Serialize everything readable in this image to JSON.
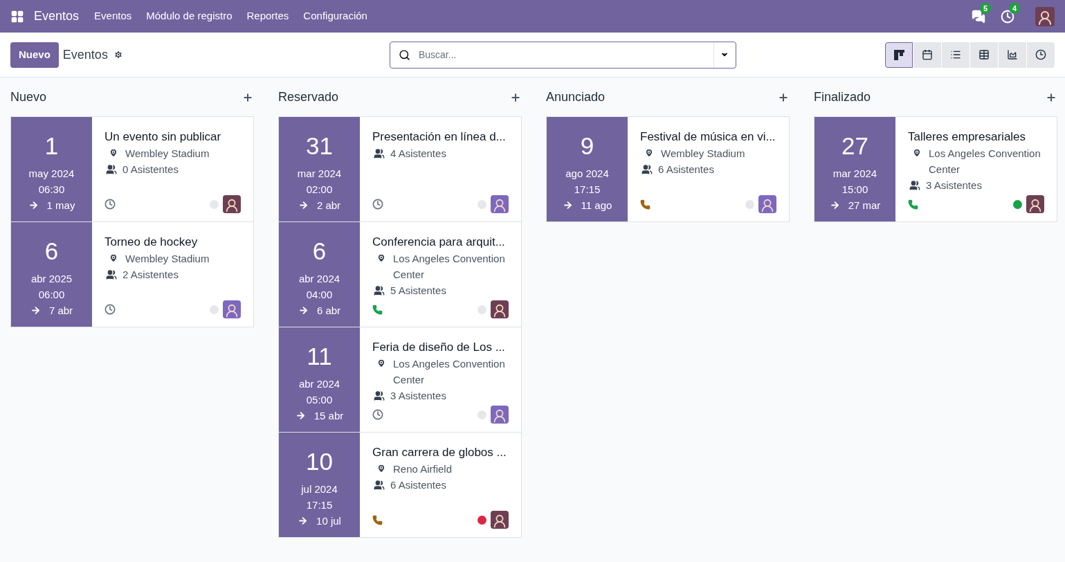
{
  "navbar": {
    "app_name": "Eventos",
    "menu": [
      "Eventos",
      "Módulo de registro",
      "Reportes",
      "Configuración"
    ],
    "messages_badge": "5",
    "activities_badge": "4"
  },
  "control_panel": {
    "new_button": "Nuevo",
    "breadcrumb": "Eventos",
    "search": {
      "placeholder": "Buscar..."
    },
    "views": [
      {
        "kind": "kanban",
        "selected": true
      },
      {
        "kind": "calendar",
        "selected": false
      },
      {
        "kind": "list",
        "selected": false
      },
      {
        "kind": "pivot",
        "selected": false
      },
      {
        "kind": "graph",
        "selected": false
      },
      {
        "kind": "activity",
        "selected": false
      }
    ]
  },
  "columns": [
    {
      "title": "Nuevo",
      "cards": [
        {
          "day": "1",
          "month_year": "may 2024",
          "time": "06:30",
          "end": "1 may",
          "title": "Un evento sin publicar",
          "location": "Wembley Stadium",
          "attendees": "0 Asistentes",
          "activity": {
            "kind": "clock",
            "color": "#6b7280"
          },
          "status_dot": {
            "color": "#e5e7eb"
          },
          "avatar": {
            "color": "#6e3f52"
          }
        },
        {
          "day": "6",
          "month_year": "abr 2025",
          "time": "06:00",
          "end": "7 abr",
          "title": "Torneo de hockey",
          "location": "Wembley Stadium",
          "attendees": "2 Asistentes",
          "activity": {
            "kind": "clock",
            "color": "#6b7280"
          },
          "status_dot": {
            "color": "#e5e7eb"
          },
          "avatar": {
            "color": "#7d68c0"
          }
        }
      ]
    },
    {
      "title": "Reservado",
      "cards": [
        {
          "day": "31",
          "month_year": "mar 2024",
          "time": "02:00",
          "end": "2 abr",
          "title": "Presentación en línea d...",
          "attendees": "4 Asistentes",
          "activity": {
            "kind": "clock",
            "color": "#6b7280"
          },
          "status_dot": {
            "color": "#e5e7eb"
          },
          "avatar": {
            "color": "#7d68c0"
          }
        },
        {
          "day": "6",
          "month_year": "abr 2024",
          "time": "04:00",
          "end": "6 abr",
          "title": "Conferencia para arquit...",
          "location": "Los Angeles Convention Center",
          "attendees": "5 Asistentes",
          "activity": {
            "kind": "phone",
            "color": "#16a34a"
          },
          "status_dot": {
            "color": "#e5e7eb"
          },
          "avatar": {
            "color": "#6e3f52"
          }
        },
        {
          "day": "11",
          "month_year": "abr 2024",
          "time": "05:00",
          "end": "15 abr",
          "title": "Feria de diseño de Los ...",
          "location": "Los Angeles Convention Center",
          "attendees": "3 Asistentes",
          "activity": {
            "kind": "clock",
            "color": "#6b7280"
          },
          "status_dot": {
            "color": "#e5e7eb"
          },
          "avatar": {
            "color": "#7d68c0"
          }
        },
        {
          "day": "10",
          "month_year": "jul 2024",
          "time": "17:15",
          "end": "10 jul",
          "title": "Gran carrera de globos ...",
          "location": "Reno Airfield",
          "attendees": "6 Asistentes",
          "activity": {
            "kind": "phone",
            "color": "#a16207"
          },
          "status_dot": {
            "color": "#dc2646"
          },
          "avatar": {
            "color": "#6e3f52"
          }
        }
      ]
    },
    {
      "title": "Anunciado",
      "cards": [
        {
          "day": "9",
          "month_year": "ago 2024",
          "time": "17:15",
          "end": "11 ago",
          "title": "Festival de música en vi...",
          "location": "Wembley Stadium",
          "attendees": "6 Asistentes",
          "activity": {
            "kind": "phone",
            "color": "#a16207"
          },
          "status_dot": {
            "color": "#e5e7eb"
          },
          "avatar": {
            "color": "#7d68c0"
          }
        }
      ]
    },
    {
      "title": "Finalizado",
      "cards": [
        {
          "day": "27",
          "month_year": "mar 2024",
          "time": "15:00",
          "end": "27 mar",
          "title": "Talleres empresariales",
          "location": "Los Angeles Convention Center",
          "attendees": "3 Asistentes",
          "activity": {
            "kind": "phone",
            "color": "#16a34a"
          },
          "status_dot": {
            "color": "#16a34a"
          },
          "avatar": {
            "color": "#6e3f52"
          }
        }
      ]
    }
  ]
}
